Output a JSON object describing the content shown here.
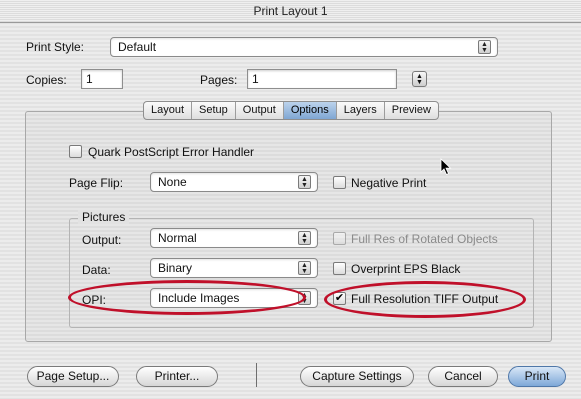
{
  "window": {
    "title": "Print Layout 1"
  },
  "print_style": {
    "label": "Print Style:",
    "value": "Default"
  },
  "copies": {
    "label": "Copies:",
    "value": "1"
  },
  "pages": {
    "label": "Pages:",
    "value": "1"
  },
  "tabs": [
    {
      "label": "Layout",
      "active": false
    },
    {
      "label": "Setup",
      "active": false
    },
    {
      "label": "Output",
      "active": false
    },
    {
      "label": "Options",
      "active": true
    },
    {
      "label": "Layers",
      "active": false
    },
    {
      "label": "Preview",
      "active": false
    }
  ],
  "options": {
    "quark_error_handler": {
      "label": "Quark PostScript Error Handler",
      "checked": false
    },
    "page_flip": {
      "label": "Page Flip:",
      "value": "None"
    },
    "negative_print": {
      "label": "Negative Print",
      "checked": false
    },
    "pictures": {
      "title": "Pictures",
      "output": {
        "label": "Output:",
        "value": "Normal"
      },
      "full_res_rotated": {
        "label": "Full Res of Rotated Objects",
        "checked": false,
        "enabled": false
      },
      "data": {
        "label": "Data:",
        "value": "Binary"
      },
      "overprint_eps": {
        "label": "Overprint EPS Black",
        "checked": false
      },
      "opi": {
        "label": "OPI:",
        "value": "Include Images"
      },
      "full_res_tiff": {
        "label": "Full Resolution TIFF Output",
        "checked": true
      }
    }
  },
  "buttons": {
    "page_setup": "Page Setup...",
    "printer": "Printer...",
    "capture_settings": "Capture Settings",
    "cancel": "Cancel",
    "print": "Print"
  },
  "colors": {
    "highlight_ring": "#c0102a",
    "active_tab": "#7fa6d3"
  }
}
